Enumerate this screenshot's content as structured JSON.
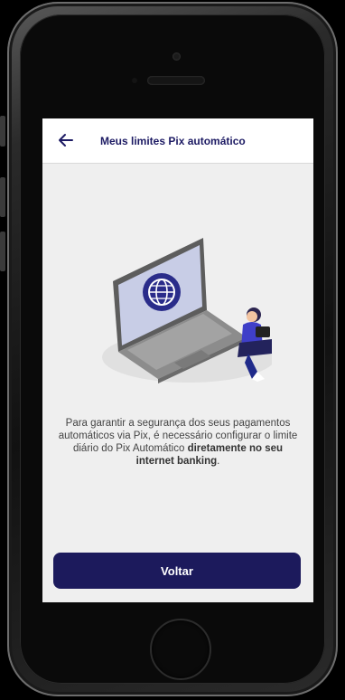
{
  "header": {
    "title": "Meus limites Pix automático",
    "back_icon": "arrow-left-icon"
  },
  "message": {
    "text": "Para garantir a segurança dos seus pagamentos automáticos via Pix, é necessário configurar o limite diário do Pix Automático",
    "bold_text": "diretamente no seu internet banking",
    "end": "."
  },
  "actions": {
    "primary_label": "Voltar"
  },
  "colors": {
    "primary": "#1c1a5c",
    "title": "#1c1a63",
    "background": "#efefef"
  }
}
